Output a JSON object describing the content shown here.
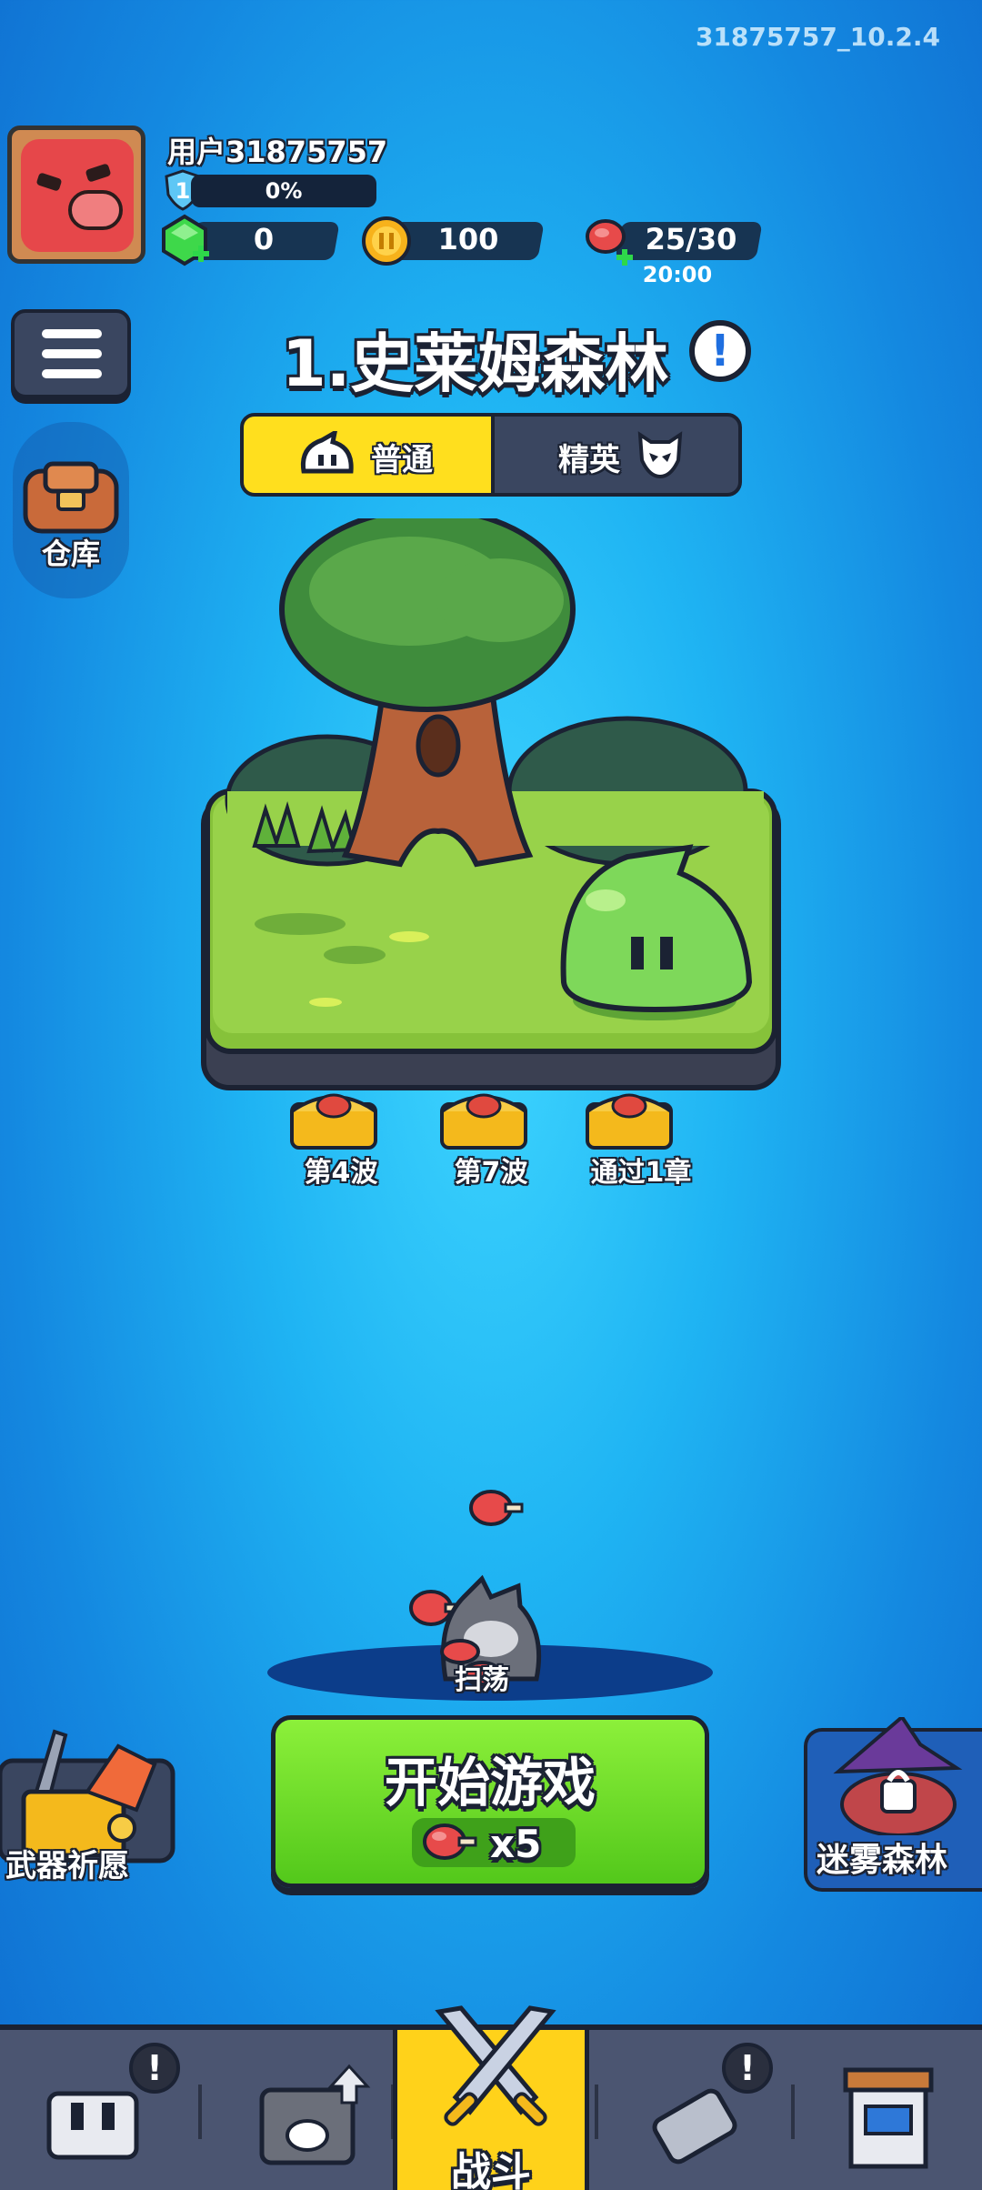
{
  "version": "31875757_10.2.4",
  "player": {
    "name": "用户31875757",
    "level": "1",
    "xp_percent": "0%"
  },
  "resources": {
    "gems": "0",
    "coins": "100",
    "energy": "25/30",
    "energy_timer": "20:00"
  },
  "sidebar": {
    "warehouse_label": "仓库"
  },
  "chapter": {
    "title": "1.史莱姆森林",
    "modes": {
      "normal": "普通",
      "elite": "精英"
    },
    "selected_mode": "normal"
  },
  "rewards": [
    {
      "label": "第4波"
    },
    {
      "label": "第7波"
    },
    {
      "label": "通过1章"
    }
  ],
  "sweep_label": "扫荡",
  "start": {
    "label": "开始游戏",
    "cost": "x5"
  },
  "side_buttons": {
    "weapon_wish": "武器祈愿",
    "mist_forest": "迷雾森林"
  },
  "bottom_nav": {
    "battle_label": "战斗",
    "active": "battle"
  },
  "colors": {
    "background": "#1fb4f3",
    "start_button": "#6bdc2a",
    "toggle_active": "#ffdf1e",
    "nav_active": "#ffd21a"
  }
}
